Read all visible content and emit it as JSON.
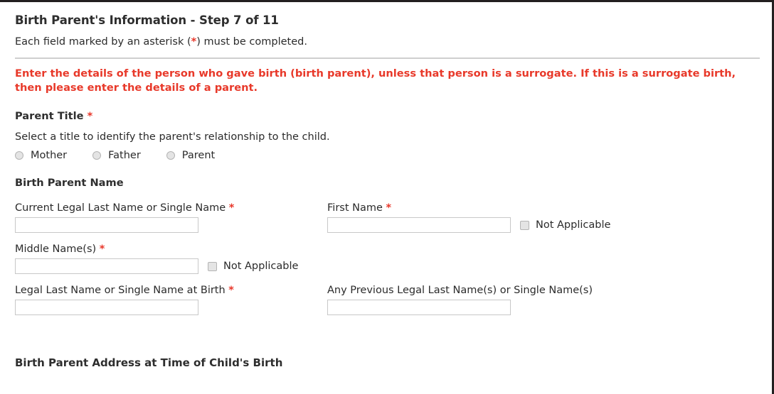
{
  "header": {
    "title": "Birth Parent's Information - Step 7 of 11",
    "asterisk_note_before": "Each field marked by an asterisk (",
    "asterisk_symbol": "*",
    "asterisk_note_after": ") must be completed."
  },
  "alert": {
    "text": "Enter the details of the person who gave birth (birth parent), unless that person is a surrogate. If this is a surrogate birth, then please enter the details of a parent."
  },
  "parent_title": {
    "label": "Parent Title",
    "required_mark": "*",
    "helper": "Select a title to identify the parent's relationship to the child.",
    "options": [
      {
        "label": "Mother",
        "selected": false
      },
      {
        "label": "Father",
        "selected": false
      },
      {
        "label": "Parent",
        "selected": false
      }
    ]
  },
  "name_section": {
    "heading": "Birth Parent Name",
    "fields": {
      "current_legal_last_name": {
        "label": "Current Legal Last Name or Single Name",
        "required_mark": "*",
        "value": "",
        "placeholder": ""
      },
      "first_name": {
        "label": "First Name",
        "required_mark": "*",
        "value": "",
        "placeholder": "",
        "checkbox_label": "Not Applicable",
        "checked": false
      },
      "middle_names": {
        "label": "Middle Name(s)",
        "required_mark": "*",
        "value": "",
        "placeholder": "",
        "checkbox_label": "Not Applicable",
        "checked": false
      },
      "legal_last_name_at_birth": {
        "label": "Legal Last Name or Single Name at Birth",
        "required_mark": "*",
        "value": "",
        "placeholder": ""
      },
      "previous_legal_last_names": {
        "label": "Any Previous Legal Last Name(s) or Single Name(s)",
        "required_mark": "",
        "value": "",
        "placeholder": ""
      }
    }
  },
  "address_section": {
    "heading": "Birth Parent Address at Time of Child's Birth"
  },
  "colors": {
    "required_red": "#e8372a",
    "alert_red": "#e8392a",
    "heading_text": "#2e2e2e",
    "body_text": "#2b2b2b",
    "input_border": "#c8c8c8",
    "divider": "#cfcfcf",
    "control_fill": "#e4e4e4",
    "page_border": "#231f20"
  }
}
